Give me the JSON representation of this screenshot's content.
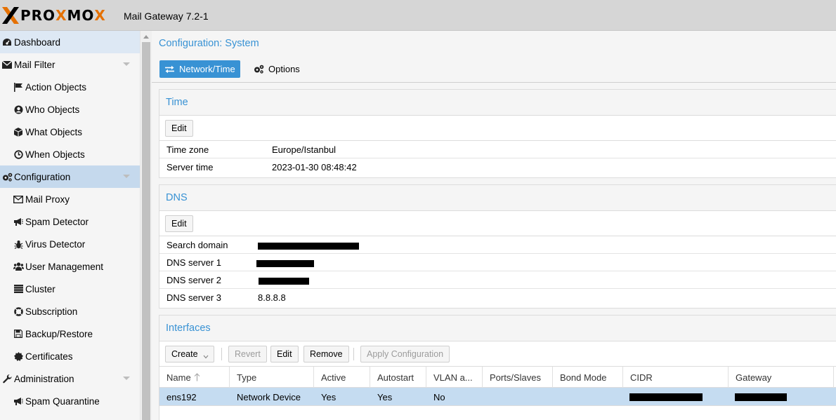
{
  "header": {
    "logo_pre": "PRO",
    "logo_x1": "X",
    "logo_mid": "MO",
    "logo_x2": "X",
    "product": "Mail Gateway 7.2-1"
  },
  "sidebar": {
    "items": [
      {
        "label": "Dashboard",
        "icon": "dashboard-icon"
      },
      {
        "label": "Mail Filter",
        "icon": "envelope-icon"
      },
      {
        "label": "Action Objects",
        "icon": "flag-icon"
      },
      {
        "label": "Who Objects",
        "icon": "user-circle-icon"
      },
      {
        "label": "What Objects",
        "icon": "cube-icon"
      },
      {
        "label": "When Objects",
        "icon": "clock-icon"
      },
      {
        "label": "Configuration",
        "icon": "gears-icon"
      },
      {
        "label": "Mail Proxy",
        "icon": "envelope-outline-icon"
      },
      {
        "label": "Spam Detector",
        "icon": "bullhorn-icon"
      },
      {
        "label": "Virus Detector",
        "icon": "bug-icon"
      },
      {
        "label": "User Management",
        "icon": "users-icon"
      },
      {
        "label": "Cluster",
        "icon": "server-icon"
      },
      {
        "label": "Subscription",
        "icon": "lifebuoy-icon"
      },
      {
        "label": "Backup/Restore",
        "icon": "floppy-icon"
      },
      {
        "label": "Certificates",
        "icon": "certificate-icon"
      },
      {
        "label": "Administration",
        "icon": "wrench-icon"
      },
      {
        "label": "Spam Quarantine",
        "icon": "bullhorn-icon"
      }
    ]
  },
  "main": {
    "title": "Configuration: System",
    "tabs": [
      {
        "label": "Network/Time",
        "icon": "exchange-icon"
      },
      {
        "label": "Options",
        "icon": "gears-icon"
      }
    ],
    "time_panel": {
      "title": "Time",
      "edit_label": "Edit",
      "rows": [
        {
          "key": "Time zone",
          "value": "Europe/Istanbul"
        },
        {
          "key": "Server time",
          "value": "2023-01-30 08:48:42"
        }
      ]
    },
    "dns_panel": {
      "title": "DNS",
      "edit_label": "Edit",
      "rows": [
        {
          "key": "Search domain",
          "value": ""
        },
        {
          "key": "DNS server 1",
          "value": ""
        },
        {
          "key": "DNS server 2",
          "value": ""
        },
        {
          "key": "DNS server 3",
          "value": "8.8.8.8"
        }
      ]
    },
    "interfaces_panel": {
      "title": "Interfaces",
      "toolbar": {
        "create": "Create",
        "revert": "Revert",
        "edit": "Edit",
        "remove": "Remove",
        "apply": "Apply Configuration"
      },
      "columns": [
        "Name",
        "Type",
        "Active",
        "Autostart",
        "VLAN a...",
        "Ports/Slaves",
        "Bond Mode",
        "CIDR",
        "Gateway"
      ],
      "rows": [
        {
          "name": "ens192",
          "type": "Network Device",
          "active": "Yes",
          "autostart": "Yes",
          "vlan": "No",
          "ports": "",
          "bond": "",
          "cidr": "",
          "gateway": ""
        }
      ]
    }
  }
}
